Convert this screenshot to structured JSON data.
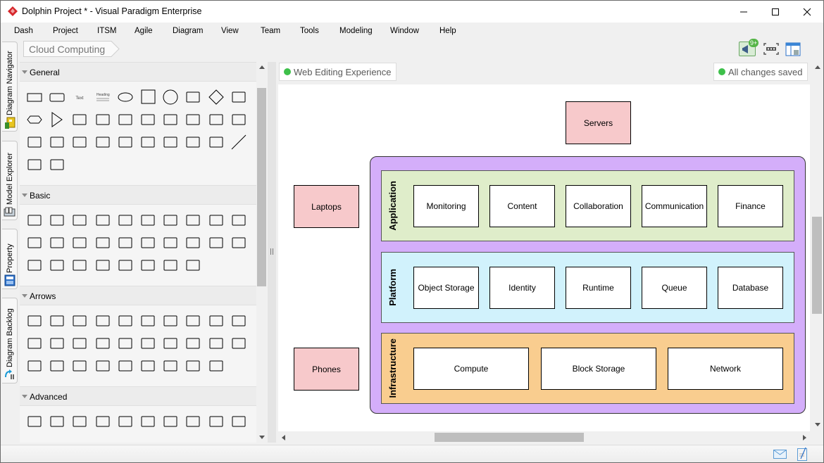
{
  "window": {
    "title": "Dolphin Project * - Visual Paradigm Enterprise",
    "controls": [
      "minimize",
      "maximize",
      "close"
    ]
  },
  "menubar": {
    "items": [
      "Dash",
      "Project",
      "ITSM",
      "Agile",
      "Diagram",
      "View",
      "Team",
      "Tools",
      "Modeling",
      "Window",
      "Help"
    ]
  },
  "side_tabs": [
    {
      "label": "Diagram Navigator",
      "icon": "diagram-navigator-icon"
    },
    {
      "label": "Model Explorer",
      "icon": "model-explorer-icon"
    },
    {
      "label": "Property",
      "icon": "property-icon"
    },
    {
      "label": "Diagram Backlog",
      "icon": "diagram-backlog-icon"
    }
  ],
  "breadcrumb": {
    "current": "Cloud Computing"
  },
  "toolbar": {
    "notifications_badge": "9+",
    "icons": [
      "announcement-icon",
      "fit-diagram-icon",
      "layout-panel-icon"
    ]
  },
  "palette": {
    "sections": [
      {
        "name": "General",
        "shapes": [
          "rectangle",
          "rounded-rectangle",
          "text",
          "heading-text",
          "ellipse",
          "square",
          "circle",
          "process",
          "diamond",
          "parallelogram",
          "hexagon",
          "triangle",
          "cylinder",
          "cloud",
          "document",
          "internal-storage",
          "box-3d",
          "chevron",
          "trapezoid",
          "wave",
          "page",
          "card",
          "callout",
          "actor",
          "curved-arrow",
          "double-arrow",
          "arrow-block",
          "thick-line",
          "dashed-line",
          "line",
          "double-headed-line",
          "single-arrow-line"
        ]
      },
      {
        "name": "Basic",
        "shapes": [
          "star-4",
          "star-6",
          "star-8",
          "banner",
          "cloud-callout",
          "cone",
          "cross",
          "folded-corner",
          "lightning",
          "half-circle",
          "heart",
          "oval-callout",
          "moon",
          "no-symbol",
          "octagon",
          "right-triangle",
          "speech-bubble",
          "parallelogram",
          "pentagon",
          "rectangle-callout",
          "rounded-callout",
          "smiley",
          "star-5",
          "sun",
          "check",
          "trapezoid",
          "wave",
          "x-shape"
        ]
      },
      {
        "name": "Arrows",
        "shapes": [
          "right-arrow",
          "left-arrow",
          "up-arrow",
          "down-arrow",
          "chevron",
          "striped-right-arrow",
          "pentagon-arrow",
          "flat-arrow",
          "thin-right-arrow",
          "left-right-arrow",
          "left-right-arrow-2",
          "notched-arrow",
          "right-arrow-2",
          "right-arrow-3",
          "callout-arrow",
          "bent-arrow",
          "bent-up-arrow",
          "corner-arrow",
          "curved-corner-arrow",
          "left-right-hex",
          "quad-arrow",
          "callout-quad",
          "quad-arrow-2",
          "left-right-up",
          "pentagon-callout",
          "notched-right",
          "striped-arrow",
          "curved-right",
          "u-turn"
        ]
      },
      {
        "name": "Advanced",
        "shapes": [
          "crescent",
          "d-shape",
          "tape",
          "circle-tail",
          "manual-input",
          "rounded-top",
          "off-page",
          "terminator",
          "display",
          "left-arrow-box"
        ]
      }
    ]
  },
  "canvas": {
    "status_left": "Web Editing Experience",
    "status_right": "All changes saved",
    "status_color": "#3ec04a",
    "clients": [
      {
        "label": "Servers"
      },
      {
        "label": "Laptops"
      },
      {
        "label": "Phones"
      }
    ],
    "layers": [
      {
        "name": "Application",
        "color": "#dfedca",
        "items": [
          "Monitoring",
          "Content",
          "Collaboration",
          "Communication",
          "Finance"
        ]
      },
      {
        "name": "Platform",
        "color": "#d1f2fc",
        "items": [
          "Object Storage",
          "Identity",
          "Runtime",
          "Queue",
          "Database"
        ]
      },
      {
        "name": "Infrastructure",
        "color": "#f9cd8f",
        "items": [
          "Compute",
          "Block Storage",
          "Network"
        ]
      }
    ],
    "container_color": "#d4aefa",
    "client_color": "#f7c9cb"
  },
  "statusbar": {
    "icons": [
      "mail-icon",
      "edit-document-icon"
    ]
  }
}
